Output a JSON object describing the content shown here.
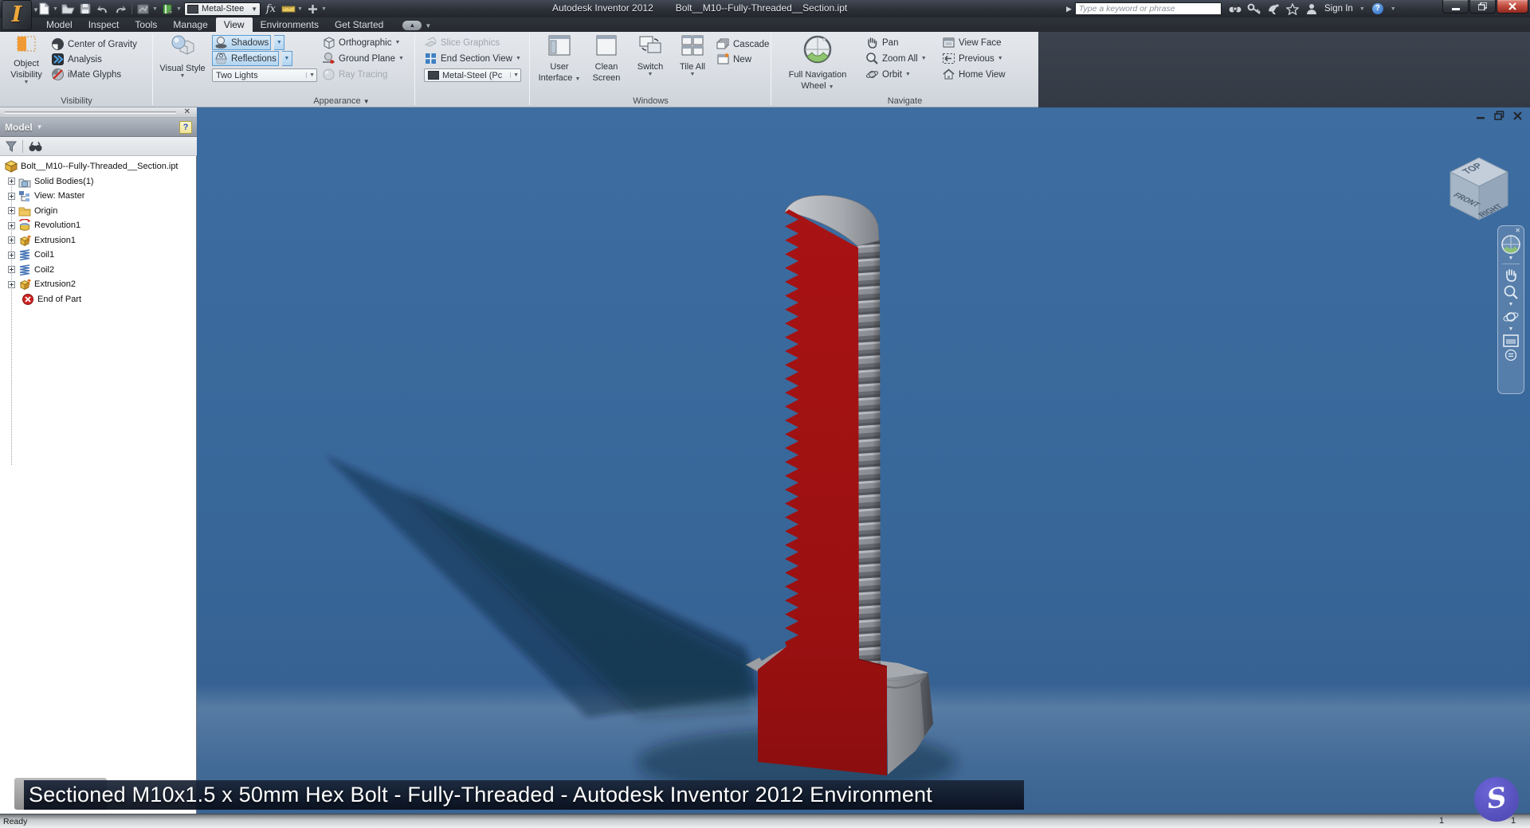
{
  "titlebar": {
    "app_title": "Autodesk Inventor 2012",
    "doc_title": "Bolt__M10--Fully-Threaded__Section.ipt",
    "search_placeholder": "Type a keyword or phrase",
    "sign_in": "Sign In",
    "material": "Metal-Stee",
    "fx": "fx",
    "help": "?"
  },
  "tabs": [
    {
      "label": "Model"
    },
    {
      "label": "Inspect"
    },
    {
      "label": "Tools"
    },
    {
      "label": "Manage"
    },
    {
      "label": "View"
    },
    {
      "label": "Environments"
    },
    {
      "label": "Get Started"
    }
  ],
  "ribbon": {
    "visibility": {
      "label": "Visibility",
      "object_visibility_1": "Object",
      "object_visibility_2": "Visibility",
      "center_of_gravity": "Center of Gravity",
      "analysis": "Analysis",
      "imate_glyphs": "iMate Glyphs"
    },
    "appearance": {
      "label": "Appearance",
      "visual_style": "Visual Style",
      "shadows": "Shadows",
      "reflections": "Reflections",
      "lights": "Two Lights",
      "orthographic": "Orthographic",
      "ground_plane": "Ground Plane",
      "ray_tracing": "Ray Tracing",
      "slice_graphics": "Slice Graphics",
      "end_section_view": "End Section View",
      "material_style": "Metal-Steel (Pc"
    },
    "windows": {
      "label": "Windows",
      "user_interface_1": "User",
      "user_interface_2": "Interface",
      "clean_screen_1": "Clean",
      "clean_screen_2": "Screen",
      "switch": "Switch",
      "tile_all": "Tile All",
      "cascade": "Cascade",
      "new": "New"
    },
    "navigate": {
      "label": "Navigate",
      "wheel_1": "Full Navigation",
      "wheel_2": "Wheel",
      "pan": "Pan",
      "zoom_all": "Zoom All",
      "orbit": "Orbit",
      "view_face": "View Face",
      "previous": "Previous",
      "home_view": "Home View"
    }
  },
  "browser": {
    "header": "Model",
    "help": "?",
    "tree": [
      {
        "label": "Bolt__M10--Fully-Threaded__Section.ipt",
        "icon": "part"
      },
      {
        "label": "Solid Bodies(1)",
        "icon": "solid-bodies"
      },
      {
        "label": "View: Master",
        "icon": "view-master"
      },
      {
        "label": "Origin",
        "icon": "origin-folder"
      },
      {
        "label": "Revolution1",
        "icon": "revolution"
      },
      {
        "label": "Extrusion1",
        "icon": "extrusion"
      },
      {
        "label": "Coil1",
        "icon": "coil"
      },
      {
        "label": "Coil2",
        "icon": "coil"
      },
      {
        "label": "Extrusion2",
        "icon": "extrusion"
      },
      {
        "label": "End of Part",
        "icon": "end-of-part"
      }
    ]
  },
  "viewport": {
    "viewcube": {
      "top": "TOP",
      "front": "FRONT",
      "right": "RIGHT"
    }
  },
  "caption": {
    "text": "Sectioned M10x1.5 x 50mm Hex Bolt - Fully-Threaded - Autodesk Inventor 2012 Environment"
  },
  "statusbar": {
    "message": "Ready",
    "value1": "1",
    "value2": "1"
  }
}
